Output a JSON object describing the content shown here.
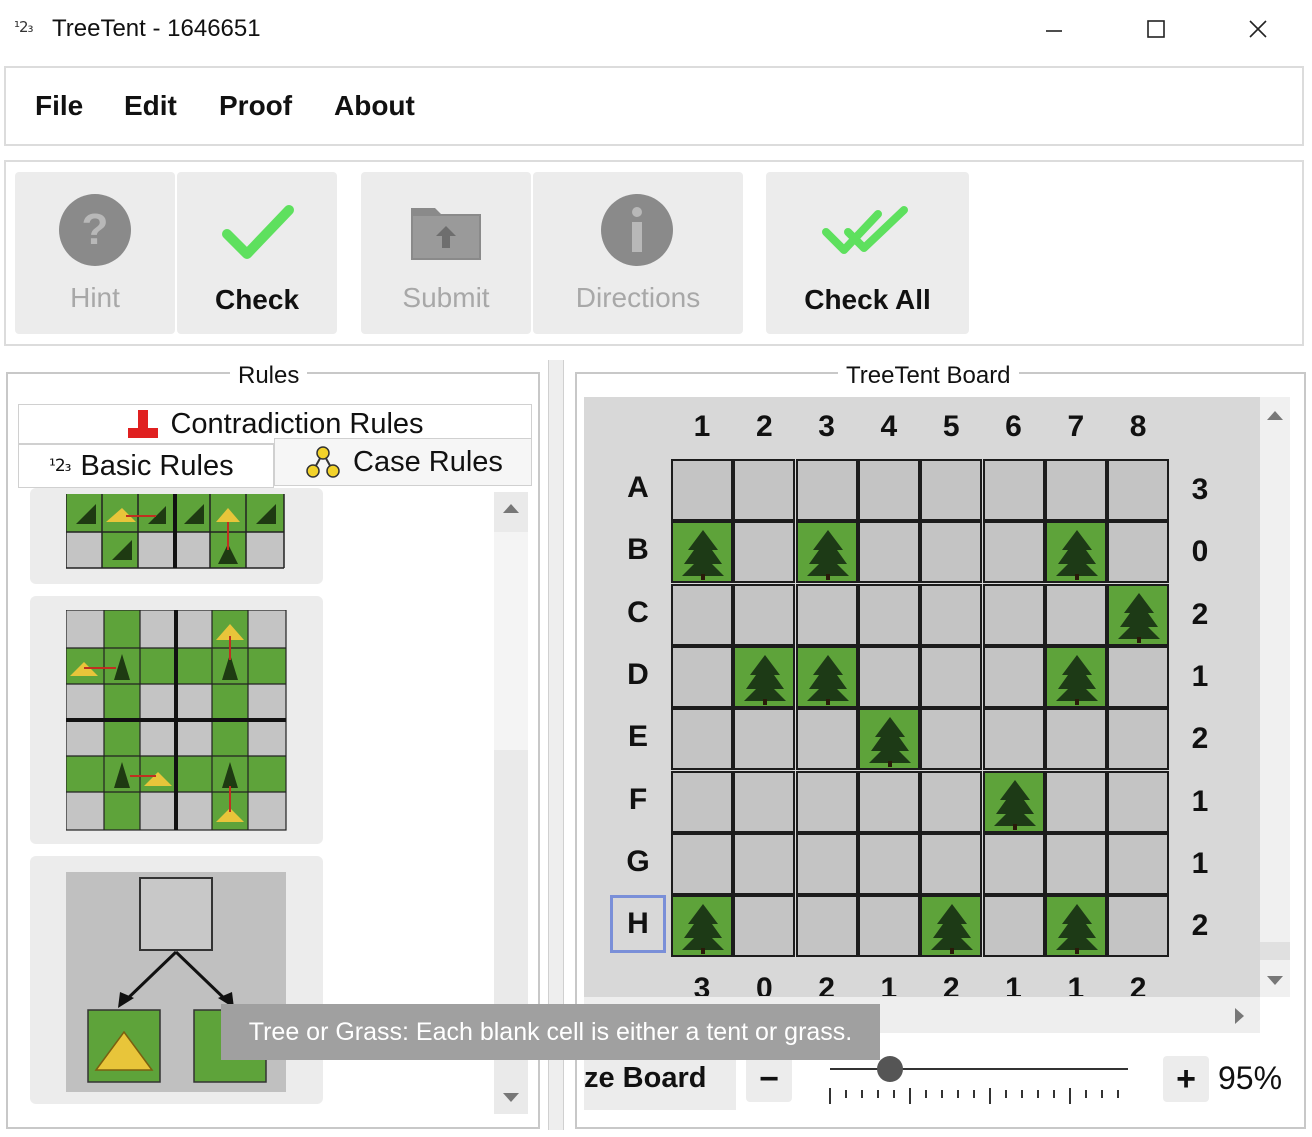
{
  "window": {
    "title": "TreeTent - 1646651",
    "icon_text": "¹2₃",
    "controls": [
      "minimize-icon",
      "maximize-icon",
      "close-icon"
    ]
  },
  "menu": {
    "items": [
      "File",
      "Edit",
      "Proof",
      "About"
    ]
  },
  "toolbar": {
    "hint": "Hint",
    "check": "Check",
    "submit": "Submit",
    "directions": "Directions",
    "check_all": "Check All"
  },
  "rules_panel": {
    "title": "Rules",
    "tabs": {
      "contradiction": "Contradiction Rules",
      "basic": "Basic Rules",
      "case": "Case Rules"
    }
  },
  "board_panel": {
    "title": "TreeTent Board",
    "columns": [
      "1",
      "2",
      "3",
      "4",
      "5",
      "6",
      "7",
      "8"
    ],
    "rows": [
      "A",
      "B",
      "C",
      "D",
      "E",
      "F",
      "G",
      "H"
    ],
    "row_counts": [
      "3",
      "0",
      "2",
      "1",
      "2",
      "1",
      "1",
      "2"
    ],
    "col_counts": [
      "3",
      "0",
      "2",
      "1",
      "2",
      "1",
      "1",
      "2"
    ],
    "trees": [
      [
        1,
        0
      ],
      [
        1,
        2
      ],
      [
        1,
        6
      ],
      [
        2,
        7
      ],
      [
        3,
        1
      ],
      [
        3,
        2
      ],
      [
        3,
        6
      ],
      [
        4,
        3
      ],
      [
        5,
        5
      ],
      [
        7,
        0
      ],
      [
        7,
        4
      ],
      [
        7,
        6
      ]
    ],
    "selected_row_label": "H",
    "colors": {
      "tree_cell": "#5ea33a",
      "empty_cell": "#c4c4c4"
    }
  },
  "zoom": {
    "resize_label": "ze Board",
    "minus": "−",
    "plus": "+",
    "percent": "95%",
    "level": 0.2
  },
  "tooltip": "Tree or Grass: Each blank cell is either a tent or grass."
}
